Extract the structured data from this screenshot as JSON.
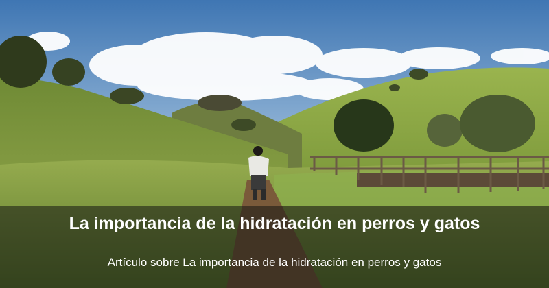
{
  "banner": {
    "title": "La importancia de la hidratación en perros y gatos",
    "subtitle": "Artículo sobre La importancia de la hidratación en perros y gatos"
  },
  "colors": {
    "sky": "#4f86c0",
    "grass": "#8ea34a",
    "overlay": "#14160f",
    "text": "#ffffff"
  }
}
